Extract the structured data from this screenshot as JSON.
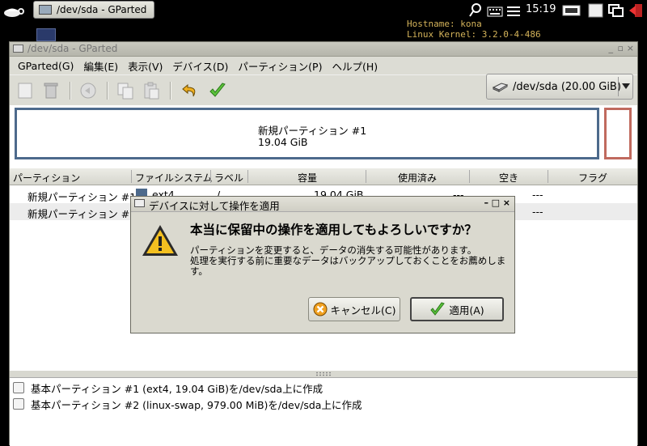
{
  "panel": {
    "task_title": "/dev/sda - GParted",
    "clock": "15:19",
    "sysinfo": "Hostname: kona\nLinux Kernel: 3.2.0-4-486"
  },
  "window": {
    "title": "/dev/sda - GParted",
    "menu": [
      "GParted(G)",
      "編集(E)",
      "表示(V)",
      "デバイス(D)",
      "パーティション(P)",
      "ヘルプ(H)"
    ],
    "device_selector": "/dev/sda  (20.00 GiB)"
  },
  "map": {
    "partition1_name": "新規パーティション #1",
    "partition1_size": "19.04 GiB"
  },
  "list": {
    "columns": [
      "パーティション",
      "ファイルシステム",
      "ラベル",
      "容量",
      "使用済み",
      "空き",
      "フラグ"
    ],
    "rows": [
      {
        "name": "新規パーティション #1",
        "fs": "ext4",
        "label": "/",
        "size": "19.04 GiB",
        "used": "---",
        "free": "---"
      },
      {
        "name": "新規パーティション #2",
        "fs": "",
        "label": "",
        "size": "",
        "used": "",
        "free": "---"
      }
    ]
  },
  "operations": [
    "基本パーティション #1 (ext4, 19.04 GiB)を/dev/sda上に作成",
    "基本パーティション #2 (linux-swap, 979.00 MiB)を/dev/sda上に作成"
  ],
  "dialog": {
    "title": "デバイスに対して操作を適用",
    "heading": "本当に保留中の操作を適用してもよろしいですか？",
    "body": "パーティションを変更すると、データの消失する可能性があります。\n処理を実行する前に重要なデータはバックアップしておくことをお薦めします。",
    "cancel_label": "キャンセル(C)",
    "apply_label": "適用(A)"
  }
}
